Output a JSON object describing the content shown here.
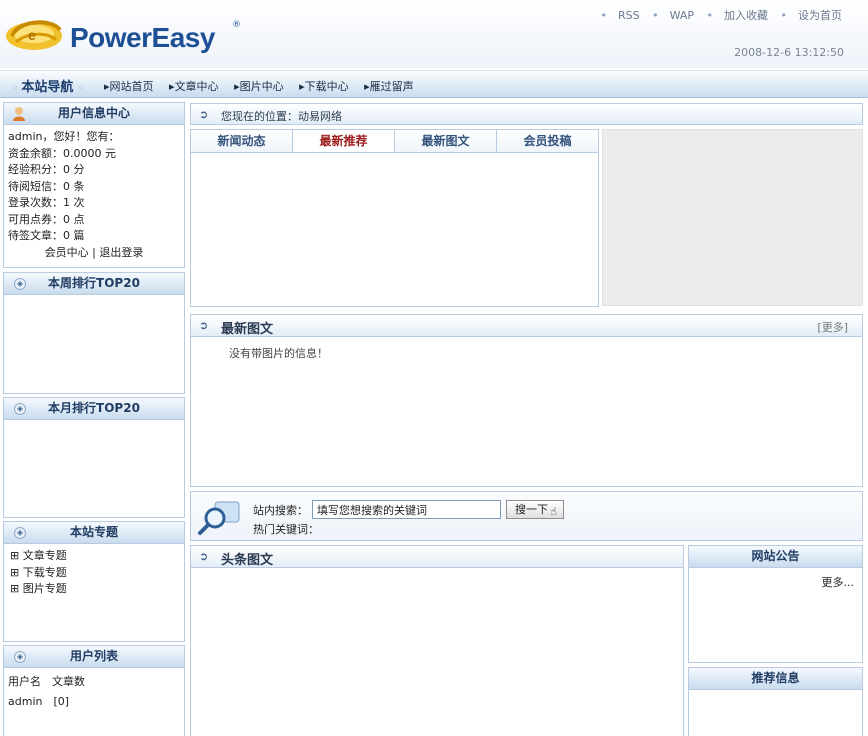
{
  "header": {
    "logo_text": "PowerEasy",
    "logo_reg": "®",
    "top_links": [
      "RSS",
      "WAP",
      "加入收藏",
      "设为首页"
    ],
    "datetime": "2008-12-6 13:12:50"
  },
  "nav": {
    "title": "本站导航",
    "items": [
      "网站首页",
      "文章中心",
      "图片中心",
      "下载中心",
      "雁过留声"
    ]
  },
  "user_info": {
    "title": "用户信息中心",
    "lines": [
      "admin，您好！您有：",
      "资金余额：0.0000 元",
      "经验积分：0 分",
      "待阅短信：0 条",
      "登录次数：1 次",
      "可用点券：0 点",
      "待签文章：0 篇"
    ],
    "links": "会员中心 | 退出登录"
  },
  "week_top": {
    "title": "本周排行TOP20"
  },
  "month_top": {
    "title": "本月排行TOP20"
  },
  "special": {
    "title": "本站专题",
    "items": [
      "⊞ 文章专题",
      "⊞ 下载专题",
      "⊞ 图片专题"
    ]
  },
  "userlist": {
    "title": "用户列表",
    "header": "用户名　文章数",
    "row": "admin　[0]"
  },
  "location": {
    "text": "您现在的位置：动易网络"
  },
  "tabs": [
    "新闻动态",
    "最新推荐",
    "最新图文",
    "会员投稿"
  ],
  "latest_pics": {
    "title": "最新图文",
    "more": "[更多]",
    "empty": "没有带图片的信息！"
  },
  "search": {
    "label": "站内搜索：",
    "value": "填写您想搜索的关键词",
    "button": "搜一下",
    "hot": "热门关键词："
  },
  "headline": {
    "title": "头条图文"
  },
  "notice": {
    "title": "网站公告",
    "more": "更多..."
  },
  "recommend": {
    "title": "推荐信息"
  },
  "colors": {
    "accent": "#1d4f94",
    "border": "#b8cbe0",
    "active_tab": "#9e1b1b"
  },
  "icons": [
    "logo-swirl-icon",
    "user-icon",
    "circle-arrow-icon",
    "search-magnifier-icon",
    "hand-cursor-icon"
  ]
}
